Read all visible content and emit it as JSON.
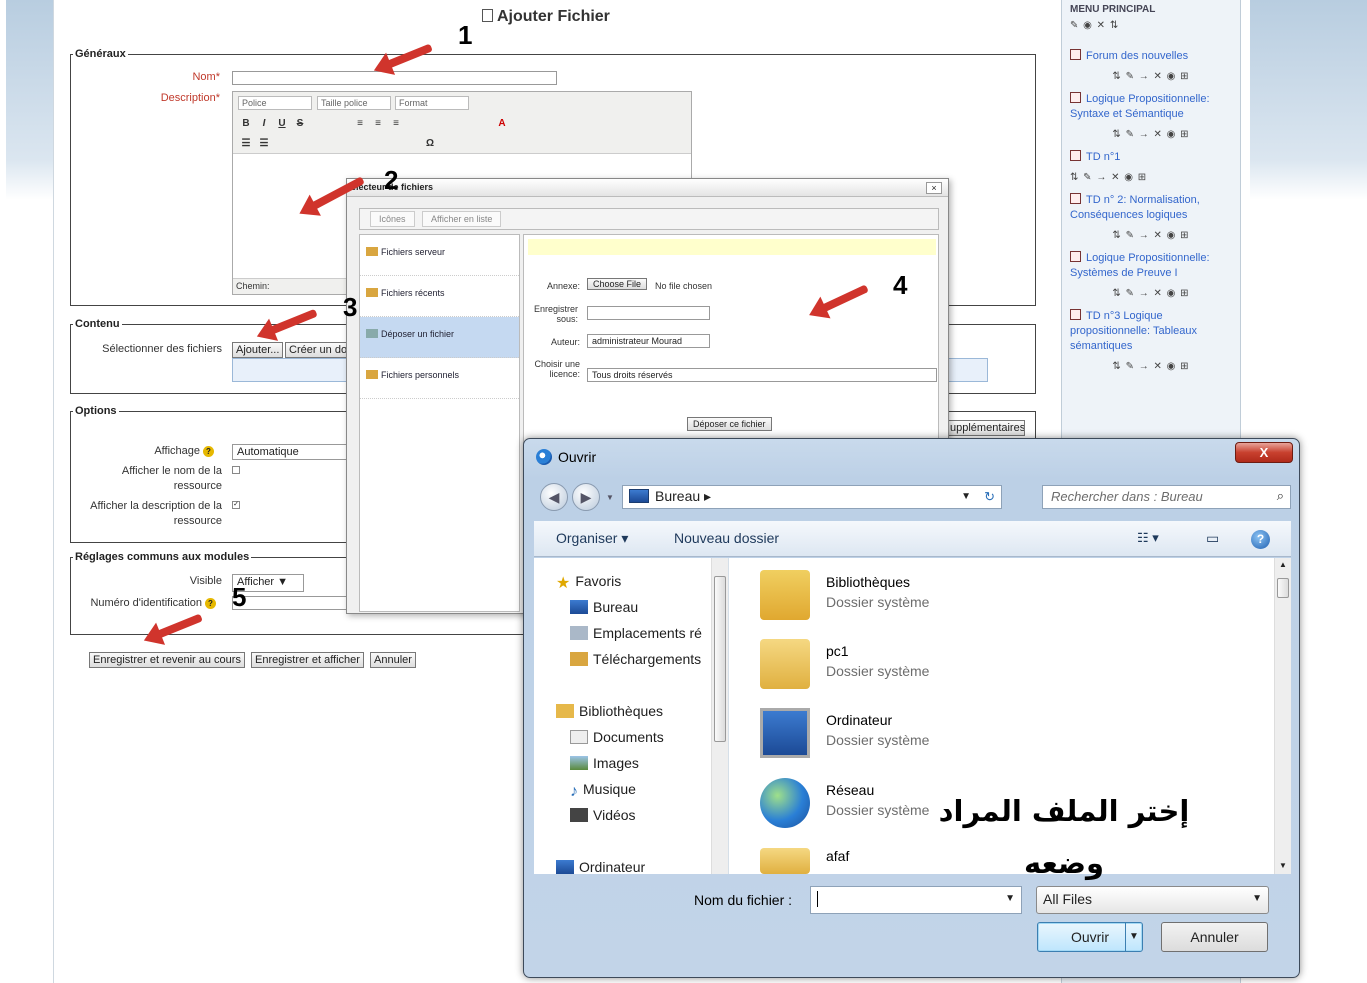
{
  "page": {
    "title": "Ajouter Fichier"
  },
  "sections": {
    "generaux": "Généraux",
    "contenu": "Contenu",
    "options": "Options",
    "reglages": "Réglages communs aux modules"
  },
  "form": {
    "nom_label": "Nom*",
    "description_label": "Description*",
    "editor": {
      "font": "Police",
      "size": "Taille police",
      "format": "Format",
      "path_label": "Chemin:"
    },
    "select_files_label": "Sélectionner des fichiers",
    "add_btn": "Ajouter...",
    "create_btn": "Créer un do",
    "affichage_label": "Affichage",
    "affichage_value": "Automatique",
    "show_name_label": "Afficher le nom de la ressource",
    "show_desc_label": "Afficher la description de la ressource",
    "more_btn": "upplémentaires",
    "visible_label": "Visible",
    "visible_value": "Afficher",
    "id_label": "Numéro d'identification",
    "save_return": "Enregistrer et revenir au cours",
    "save_show": "Enregistrer et afficher",
    "cancel": "Annuler"
  },
  "annotations": {
    "n1": "1",
    "n2": "2",
    "n3": "3",
    "n4": "4",
    "n5": "5"
  },
  "sidebar": {
    "head": "MENU PRINCIPAL",
    "items": [
      {
        "label": "Forum des nouvelles"
      },
      {
        "label": "Logique Propositionnelle: Syntaxe et Sémantique"
      },
      {
        "label": "TD n°1"
      },
      {
        "label": "TD n° 2: Normalisation, Conséquences logiques"
      },
      {
        "label": "Logique Propositionnelle: Systèmes de Preuve I"
      },
      {
        "label": "TD n°3 Logique propositionnelle: Tableaux sémantiques"
      }
    ]
  },
  "picker": {
    "title": "électeur de fichiers",
    "close": "×",
    "tab_icons": "Icônes",
    "tab_list": "Afficher en liste",
    "repos": [
      "Fichiers serveur",
      "Fichiers récents",
      "Déposer un fichier",
      "Fichiers personnels"
    ],
    "annexe_label": "Annexe:",
    "choose_btn": "Choose File",
    "no_file": "No file chosen",
    "save_as_label": "Enregistrer sous:",
    "author_label": "Auteur:",
    "author_value": "administrateur Mourad",
    "license_label": "Choisir une licence:",
    "license_value": "Tous droits réservés",
    "upload_btn": "Déposer ce fichier"
  },
  "dialog": {
    "title": "Ouvrir",
    "close": "X",
    "address": "Bureau",
    "search_placeholder": "Rechercher dans : Bureau",
    "organize": "Organiser",
    "new_folder": "Nouveau dossier",
    "nav": {
      "favoris": "Favoris",
      "bureau": "Bureau",
      "emplacements": "Emplacements ré",
      "telechargements": "Téléchargements",
      "bibliotheques": "Bibliothèques",
      "documents": "Documents",
      "images": "Images",
      "musique": "Musique",
      "videos": "Vidéos",
      "ordinateur": "Ordinateur"
    },
    "files": [
      {
        "name": "Bibliothèques",
        "type": "Dossier système"
      },
      {
        "name": "pc1",
        "type": "Dossier système"
      },
      {
        "name": "Ordinateur",
        "type": "Dossier système"
      },
      {
        "name": "Réseau",
        "type": "Dossier système"
      },
      {
        "name": "afaf",
        "type": ""
      }
    ],
    "overlay_line1": "إختر الملف المراد",
    "overlay_line2": "وضعه",
    "filename_label": "Nom du fichier :",
    "filetype": "All Files",
    "open_btn": "Ouvrir",
    "cancel_btn": "Annuler"
  }
}
